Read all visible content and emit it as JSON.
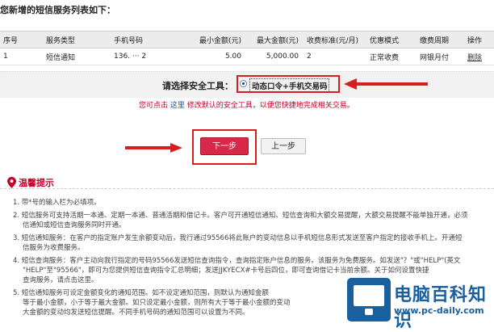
{
  "page": {
    "heading": "您新增的短信服务列表如下："
  },
  "table": {
    "headers": [
      "序号",
      "服务类型",
      "手机号码",
      "最小金额(元)",
      "最大金额(元)",
      "收费标准(元/月)",
      "优惠模式",
      "缴费周期",
      "操作"
    ],
    "rows": [
      [
        "1",
        "短信通知",
        "136.  ···  2",
        "5.00",
        "5,000.00",
        "2",
        "正常收费",
        "网银月付",
        "删除"
      ]
    ]
  },
  "security": {
    "label": "请选择安全工具：",
    "option": "动态口令+手机交易码",
    "hint_prefix": "您可点击",
    "hint_link": "这里",
    "hint_suffix": "修改默认的安全工具，以便您快捷地完成相关交易。"
  },
  "buttons": {
    "next": "下一步",
    "prev": "上一步"
  },
  "tips": {
    "title": "温馨提示",
    "items": [
      [
        "1. 带*号的输入栏为必填项。"
      ],
      [
        "2. 短信服务可支持活期一本通、定期一本通、普通活期和借记卡。客户可开通短信通知、短信查询和大额交易提醒，大额交易提醒不能单独开通，必须",
        "信通知或短信查询服务同时开通。"
      ],
      [
        "3. 短信通知服务：在客户的指定账户发生余额变动后，我行通过95566将此账户的变动信息以手机短信息形式发送至客户指定的接收手机上。开通短",
        "信服务为收费服务。"
      ],
      [
        "4. 短信查询服务：客户主动向我行指定的号码95566发送短信查询指令，查询指定账户信息的服务。该服务为免费服务。如发送\"？\"或\"HELP\"(英文",
        "\"HELP\"至\"95566\"，即可为您提供短信查询指令汇总明细；发送JJKYECX#卡号后四位，即可查询借记卡当前余额。关于如何设置快捷",
        "查询服务，请点击这里。"
      ],
      [
        "5. 短信通知服务可设定金额变化的通知范围。如不设定通知范围，则默认为通知金额",
        "等于最小金额，小于等于最大金额。如只设定最小金额，则所有大于等于最小金额的变动",
        "大金额的变动均发送短信提醒。不同手机号码的通知范围可以设置为不同。"
      ]
    ]
  },
  "watermark": {
    "cn": "电脑百科知识",
    "url": "www.pc-daily.com"
  },
  "colors": {
    "accent_red": "#d71f1f",
    "primary_button": "#d8284a",
    "link_blue": "#1a4ea0",
    "watermark_blue": "#1a5f9e"
  }
}
